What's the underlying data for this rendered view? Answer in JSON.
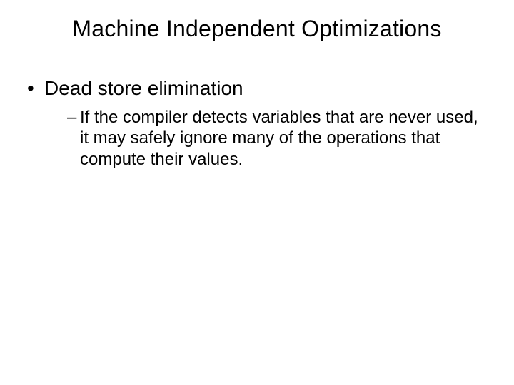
{
  "title": "Machine Independent Optimizations",
  "bullet1": {
    "marker": "•",
    "text": "Dead store elimination"
  },
  "subbullet1": {
    "marker": "–",
    "text": "If the compiler detects variables that are never used, it may safely ignore many of the operations that compute their values."
  }
}
